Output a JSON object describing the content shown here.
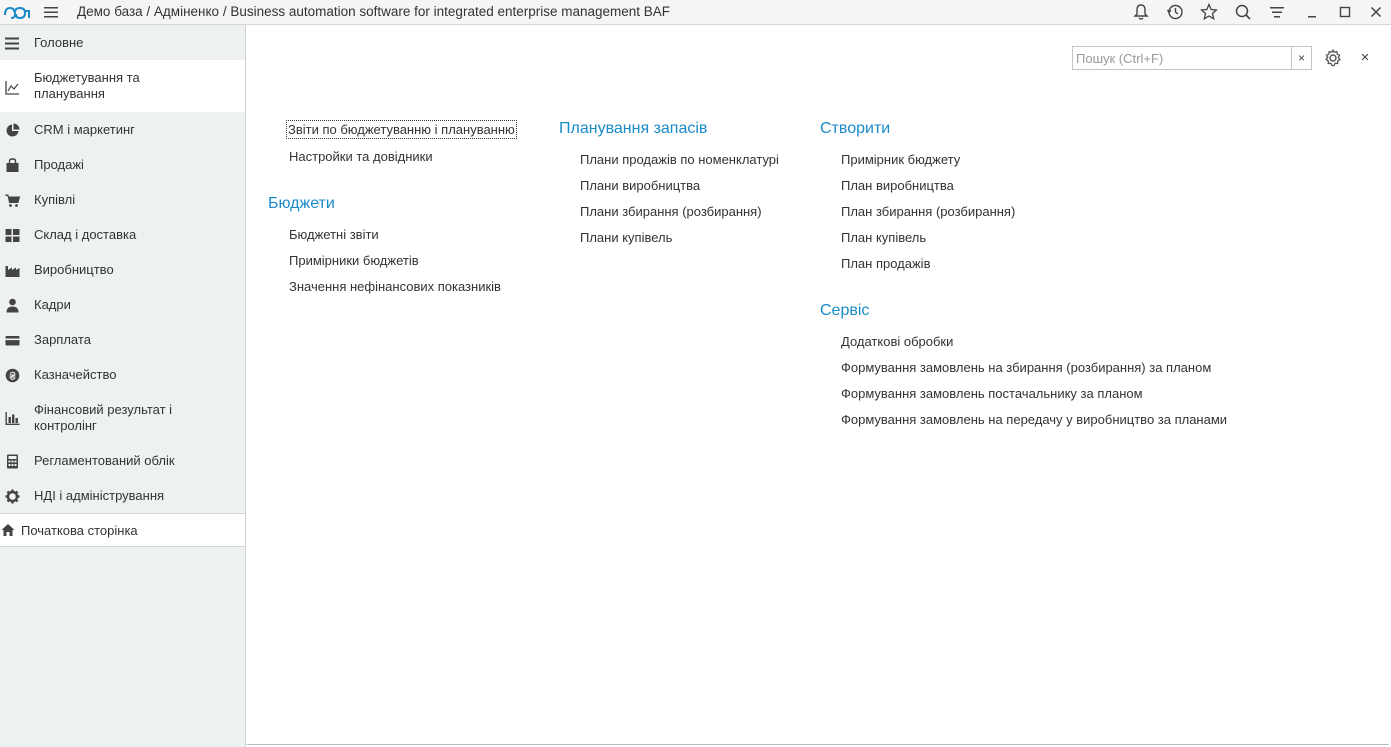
{
  "titlebar": {
    "app_title": "Демо база / Адміненко / Business automation software for integrated enterprise management BAF",
    "icons": [
      "bell-icon",
      "history-icon",
      "star-icon",
      "search-icon",
      "settings-lines-icon",
      "minimize-icon",
      "maximize-icon",
      "close-icon"
    ]
  },
  "sidebar": {
    "items": [
      {
        "label": "Головне",
        "icon": "menu-lines-icon"
      },
      {
        "label": "Бюджетування та планування",
        "icon": "chart-axis-icon"
      },
      {
        "label": "CRM і маркетинг",
        "icon": "pie-chart-icon"
      },
      {
        "label": "Продажі",
        "icon": "bag-icon"
      },
      {
        "label": "Купівлі",
        "icon": "cart-icon"
      },
      {
        "label": "Склад і доставка",
        "icon": "grid-icon"
      },
      {
        "label": "Виробництво",
        "icon": "factory-icon"
      },
      {
        "label": "Кадри",
        "icon": "person-icon"
      },
      {
        "label": "Зарплата",
        "icon": "wallet-icon"
      },
      {
        "label": "Казначейство",
        "icon": "currency-icon"
      },
      {
        "label": "Фінансовий результат і контролінг",
        "icon": "bar-chart-icon"
      },
      {
        "label": "Регламентований облік",
        "icon": "calculator-icon"
      },
      {
        "label": "НДІ і адміністрування",
        "icon": "gear-icon"
      }
    ],
    "home": {
      "label": "Початкова сторінка",
      "icon": "home-icon"
    }
  },
  "main": {
    "search": {
      "placeholder": "Пошук (Ctrl+F)",
      "clear": "×"
    },
    "close": "×",
    "col1": {
      "top_links": [
        "Звіти по бюджетуванню і плануванню",
        "Настройки та довідники"
      ],
      "section_title": "Бюджети",
      "links": [
        "Бюджетні звіти",
        "Примірники бюджетів",
        "Значення нефінансових показників"
      ]
    },
    "col2": {
      "section_title": "Планування запасів",
      "links": [
        "Плани продажів по номенклатурі",
        "Плани виробництва",
        "Плани збирання (розбирання)",
        "Плани купівель"
      ]
    },
    "col3": {
      "create_title": "Створити",
      "create_links": [
        "Примірник бюджету",
        "План виробництва",
        "План збирання (розбирання)",
        "План купівель",
        "План продажів"
      ],
      "service_title": "Сервіс",
      "service_links": [
        "Додаткові обробки",
        "Формування замовлень на збирання (розбирання) за планом",
        "Формування замовлень постачальнику за планом",
        "Формування замовлень на передачу у виробництво за планами"
      ]
    }
  }
}
